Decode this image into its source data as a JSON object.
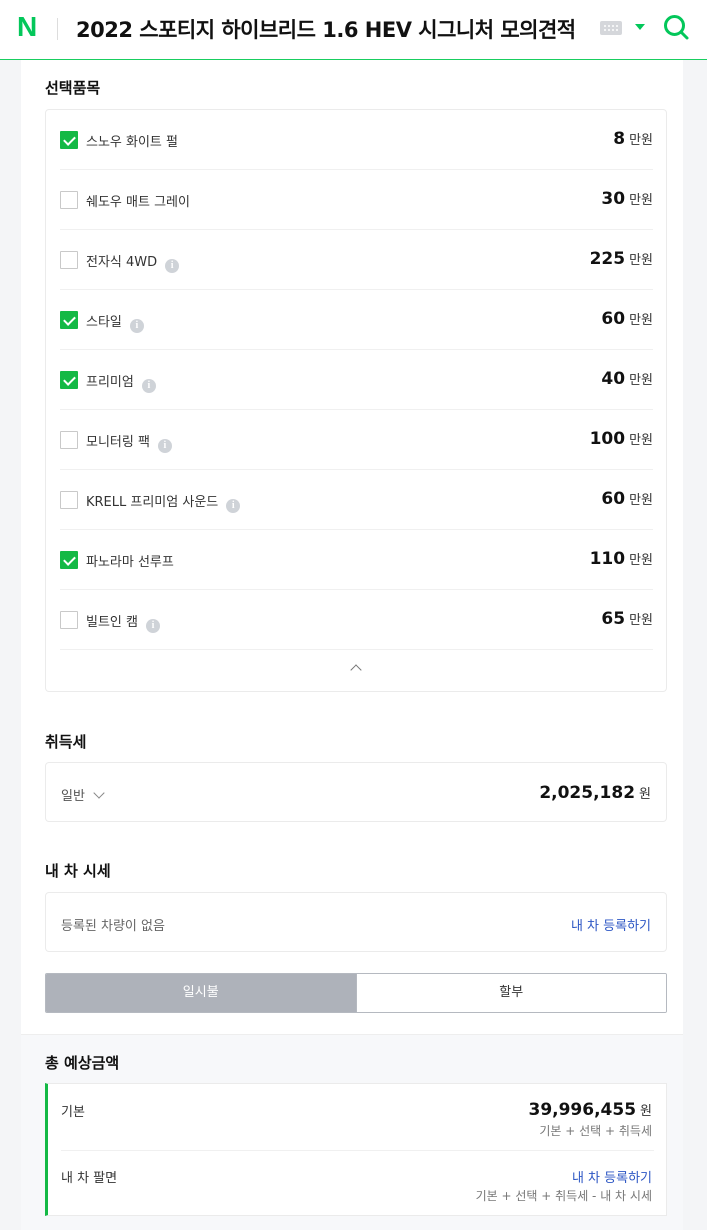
{
  "header": {
    "logo": "N",
    "title": "2022 스포티지 하이브리드 1.6 HEV 시그니처 모의견적"
  },
  "options": {
    "title": "선택품목",
    "unit": "만원",
    "items": [
      {
        "label": "스노우 화이트 펄",
        "price": "8",
        "checked": true,
        "info": false
      },
      {
        "label": "쉐도우 매트 그레이",
        "price": "30",
        "checked": false,
        "info": false
      },
      {
        "label": "전자식 4WD",
        "price": "225",
        "checked": false,
        "info": true
      },
      {
        "label": "스타일",
        "price": "60",
        "checked": true,
        "info": true
      },
      {
        "label": "프리미엄",
        "price": "40",
        "checked": true,
        "info": true
      },
      {
        "label": "모니터링 팩",
        "price": "100",
        "checked": false,
        "info": true
      },
      {
        "label": "KRELL 프리미엄 사운드",
        "price": "60",
        "checked": false,
        "info": true
      },
      {
        "label": "파노라마 선루프",
        "price": "110",
        "checked": true,
        "info": false
      },
      {
        "label": "빌트인 캠",
        "price": "65",
        "checked": false,
        "info": true
      }
    ]
  },
  "tax": {
    "title": "취득세",
    "type": "일반",
    "amount": "2,025,182",
    "unit": "원"
  },
  "my_car": {
    "title": "내 차 시세",
    "empty_text": "등록된 차량이 없음",
    "register_link": "내 차 등록하기"
  },
  "payment": {
    "tabs": [
      "일시불",
      "할부"
    ],
    "selected": "일시불"
  },
  "total": {
    "title": "총 예상금액",
    "base_label": "기본",
    "base_amount": "39,996,455",
    "unit": "원",
    "base_formula": "기본 + 선택 + 취득세",
    "trade_label": "내 차 팔면",
    "trade_link": "내 차 등록하기",
    "trade_formula": "기본 + 선택 + 취득세 - 내 차 시세"
  },
  "colors": {
    "brand": "#03c75a",
    "checked": "#14b945",
    "link": "#2c56c4"
  }
}
